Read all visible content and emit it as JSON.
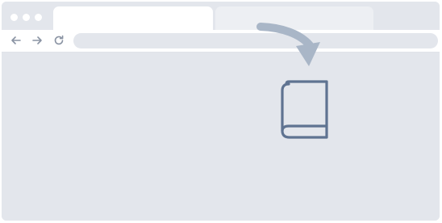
{
  "colors": {
    "chrome": "#e3e6ec",
    "active_tab": "#ffffff",
    "inactive_tab": "#edeff3",
    "icon_gray": "#8a93a3",
    "accent_blue": "#5f7391",
    "arrow_blue": "#a9b6c7"
  },
  "window_controls": [
    "dot",
    "dot",
    "dot"
  ],
  "tabs": [
    {
      "state": "active"
    },
    {
      "state": "inactive"
    }
  ],
  "toolbar": {
    "icons": [
      "back-arrow-icon",
      "forward-arrow-icon",
      "reload-icon"
    ]
  },
  "content": {
    "icons": [
      "curved-arrow-icon",
      "book-icon"
    ]
  }
}
